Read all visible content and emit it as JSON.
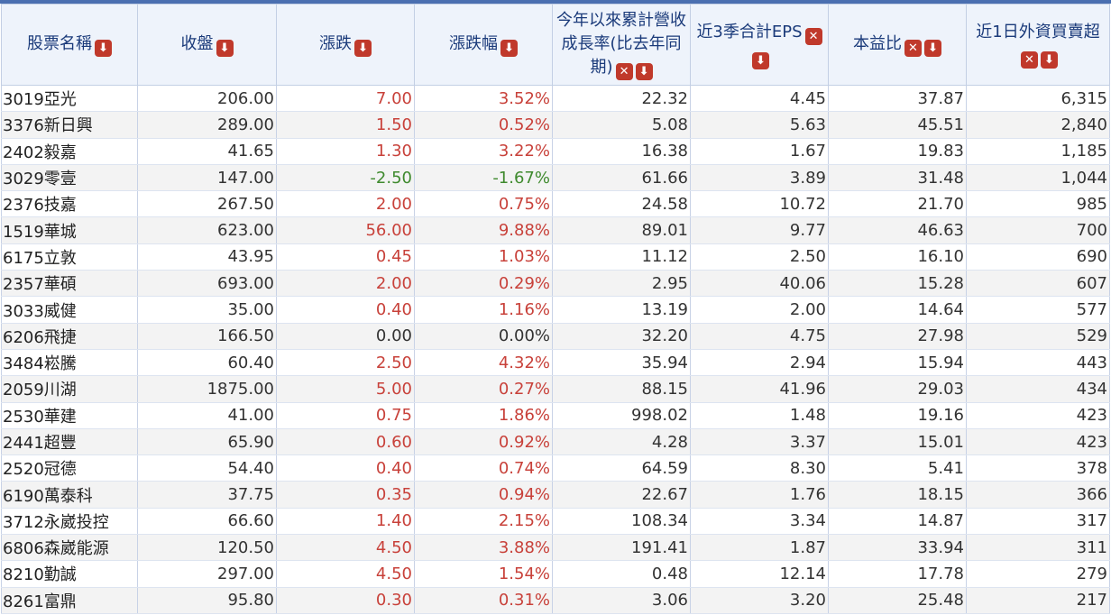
{
  "icons": {
    "sort": "⬇",
    "remove": "✕"
  },
  "columns": [
    {
      "label": "股票名稱",
      "removable": false
    },
    {
      "label": "收盤",
      "removable": false
    },
    {
      "label": "漲跌",
      "removable": false
    },
    {
      "label": "漲跌幅",
      "removable": false
    },
    {
      "label": "今年以來累計營收成長率(比去年同期)",
      "removable": true
    },
    {
      "label": "近3季合計EPS",
      "removable": true
    },
    {
      "label": "本益比",
      "removable": true
    },
    {
      "label": "近1日外資買賣超",
      "removable": true
    }
  ],
  "rows": [
    [
      "3019亞光",
      "206.00",
      "7.00",
      "3.52%",
      "22.32",
      "4.45",
      "37.87",
      "6,315"
    ],
    [
      "3376新日興",
      "289.00",
      "1.50",
      "0.52%",
      "5.08",
      "5.63",
      "45.51",
      "2,840"
    ],
    [
      "2402毅嘉",
      "41.65",
      "1.30",
      "3.22%",
      "16.38",
      "1.67",
      "19.83",
      "1,185"
    ],
    [
      "3029零壹",
      "147.00",
      "-2.50",
      "-1.67%",
      "61.66",
      "3.89",
      "31.48",
      "1,044"
    ],
    [
      "2376技嘉",
      "267.50",
      "2.00",
      "0.75%",
      "24.58",
      "10.72",
      "21.70",
      "985"
    ],
    [
      "1519華城",
      "623.00",
      "56.00",
      "9.88%",
      "89.01",
      "9.77",
      "46.63",
      "700"
    ],
    [
      "6175立敦",
      "43.95",
      "0.45",
      "1.03%",
      "11.12",
      "2.50",
      "16.10",
      "690"
    ],
    [
      "2357華碩",
      "693.00",
      "2.00",
      "0.29%",
      "2.95",
      "40.06",
      "15.28",
      "607"
    ],
    [
      "3033威健",
      "35.00",
      "0.40",
      "1.16%",
      "13.19",
      "2.00",
      "14.64",
      "577"
    ],
    [
      "6206飛捷",
      "166.50",
      "0.00",
      "0.00%",
      "32.20",
      "4.75",
      "27.98",
      "529"
    ],
    [
      "3484崧騰",
      "60.40",
      "2.50",
      "4.32%",
      "35.94",
      "2.94",
      "15.94",
      "443"
    ],
    [
      "2059川湖",
      "1875.00",
      "5.00",
      "0.27%",
      "88.15",
      "41.96",
      "29.03",
      "434"
    ],
    [
      "2530華建",
      "41.00",
      "0.75",
      "1.86%",
      "998.02",
      "1.48",
      "19.16",
      "423"
    ],
    [
      "2441超豐",
      "65.90",
      "0.60",
      "0.92%",
      "4.28",
      "3.37",
      "15.01",
      "423"
    ],
    [
      "2520冠德",
      "54.40",
      "0.40",
      "0.74%",
      "64.59",
      "8.30",
      "5.41",
      "378"
    ],
    [
      "6190萬泰科",
      "37.75",
      "0.35",
      "0.94%",
      "22.67",
      "1.76",
      "18.15",
      "366"
    ],
    [
      "3712永崴投控",
      "66.60",
      "1.40",
      "2.15%",
      "108.34",
      "3.34",
      "14.87",
      "317"
    ],
    [
      "6806森崴能源",
      "120.50",
      "4.50",
      "3.88%",
      "191.41",
      "1.87",
      "33.94",
      "311"
    ],
    [
      "8210勤誠",
      "297.00",
      "4.50",
      "1.54%",
      "0.48",
      "12.14",
      "17.78",
      "279"
    ],
    [
      "8261富鼎",
      "95.80",
      "0.30",
      "0.31%",
      "3.06",
      "3.20",
      "25.48",
      "217"
    ]
  ],
  "colors": {
    "up": "#c8413a",
    "down": "#3f8a2e",
    "header_text": "#1a3a7a"
  }
}
